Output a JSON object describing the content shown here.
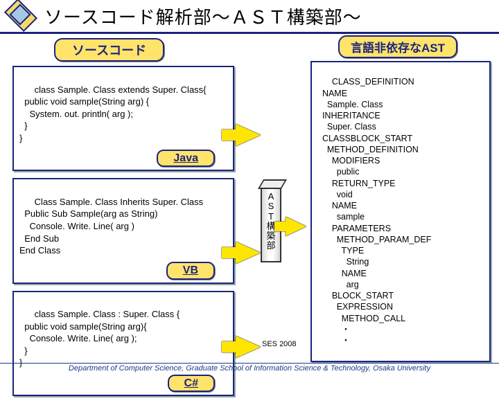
{
  "title": "ソースコード解析部～ＡＳＴ構築部～",
  "left": {
    "badge": "ソースコード",
    "codes": [
      {
        "lang_tag": "Java",
        "text": "class Sample. Class extends Super. Class{\n  public void sample(String arg) {\n    System. out. println( arg );\n  }\n}"
      },
      {
        "lang_tag": "VB",
        "text": "Class Sample. Class Inherits Super. Class\n  Public Sub Sample(arg as String)\n    Console. Write. Line( arg )\n  End Sub\nEnd Class"
      },
      {
        "lang_tag": "C#",
        "text": "class Sample. Class : Super. Class {\n  public void sample(String arg){\n    Console. Write. Line( arg );\n  }\n}"
      }
    ]
  },
  "middle": {
    "block_label": "A\nS\nT\n構\n築\n部"
  },
  "right": {
    "badge": "言語非依存なAST",
    "ast_text": "CLASS_DEFINITION\n  NAME\n    Sample. Class\n  INHERITANCE\n    Super. Class\n  CLASSBLOCK_START\n    METHOD_DEFINITION\n      MODIFIERS\n        public\n      RETURN_TYPE\n        void\n      NAME\n        sample\n      PARAMETERS\n        METHOD_PARAM_DEF\n          TYPE\n            String\n          NAME\n            arg\n      BLOCK_START\n        EXPRESSION\n          METHOD_CALL\n          ・\n          ・"
  },
  "ses": "SES 2008",
  "footer": "Department of Computer Science, Graduate School of Information Science & Technology, Osaka University"
}
